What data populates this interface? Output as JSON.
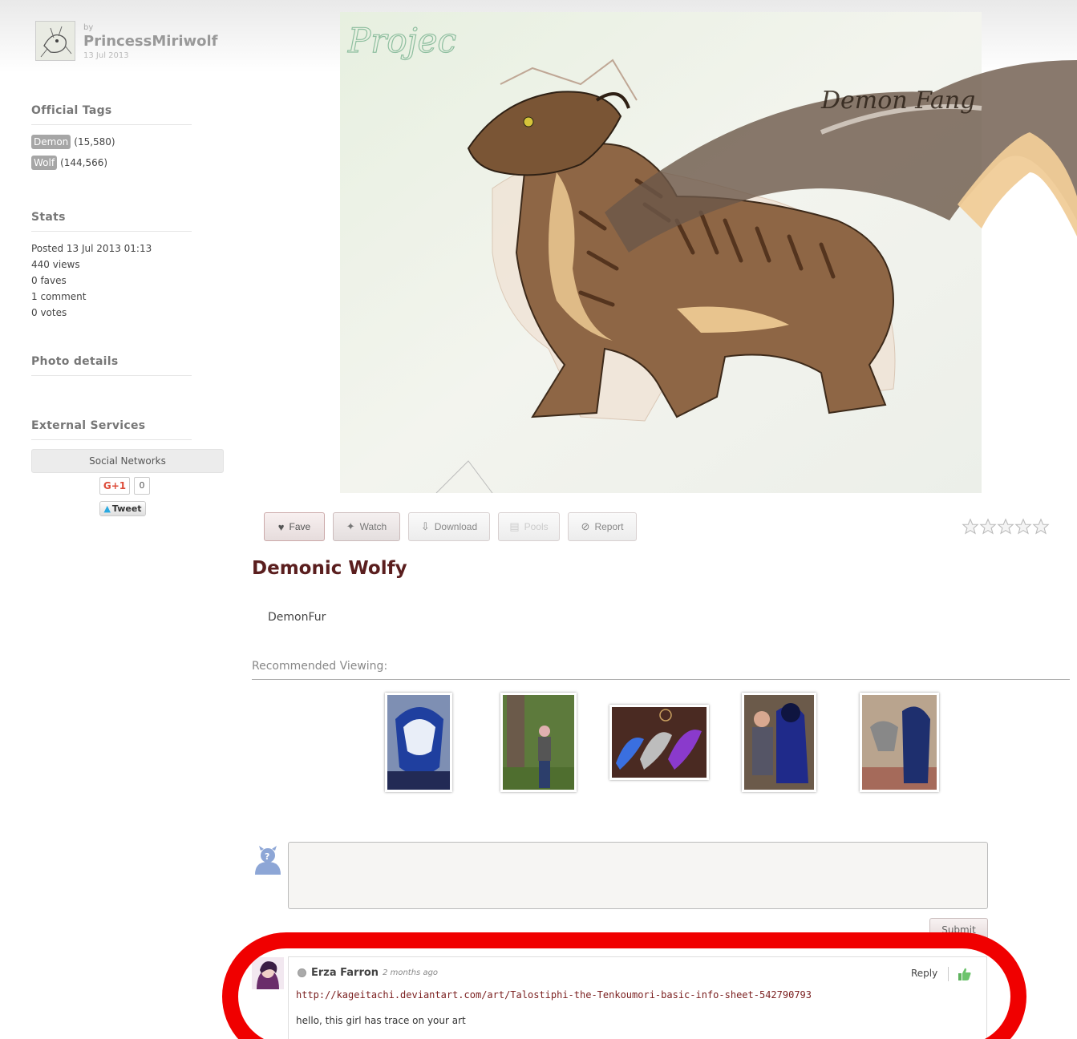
{
  "author": {
    "by_label": "by",
    "name": "PrincessMiriwolf",
    "date": "13 Jul 2013"
  },
  "sidebar": {
    "official_tags": {
      "title": "Official Tags",
      "tags": [
        {
          "name": "Demon",
          "count": "(15,580)"
        },
        {
          "name": "Wolf",
          "count": "(144,566)"
        }
      ]
    },
    "stats": {
      "title": "Stats",
      "lines": [
        "Posted 13 Jul 2013 01:13",
        "440 views",
        "0 faves",
        "1 comment",
        "0 votes"
      ]
    },
    "photo_details": {
      "title": "Photo details"
    },
    "external_services": {
      "title": "External Services",
      "social_networks_label": "Social Networks",
      "gplus_label": "G+1",
      "gplus_count": "0",
      "tweet_label": "Tweet"
    }
  },
  "artwork": {
    "handwriting_top": "Projec",
    "handwriting_name": "Demon Fang"
  },
  "actions": {
    "fave": "Fave",
    "watch": "Watch",
    "download": "Download",
    "pools": "Pools",
    "report": "Report"
  },
  "rating": {
    "stars": 0,
    "max": 5
  },
  "submission": {
    "title": "Demonic Wolfy",
    "description": "DemonFur"
  },
  "recommended": {
    "title": "Recommended Viewing:"
  },
  "comment_form": {
    "submit_label": "Submit"
  },
  "comments": [
    {
      "user": "Erza Farron",
      "time": "2 months ago",
      "reply_label": "Reply",
      "link": "http://kageitachi.deviantart.com/art/Talostiphi-the-Tenkoumori-basic-info-sheet-542790793",
      "text": "hello, this girl has trace on your art"
    }
  ],
  "colors": {
    "title": "#5a1e1e",
    "highlight_ring": "#f00000",
    "tag_pill": "#a6a6a6"
  }
}
